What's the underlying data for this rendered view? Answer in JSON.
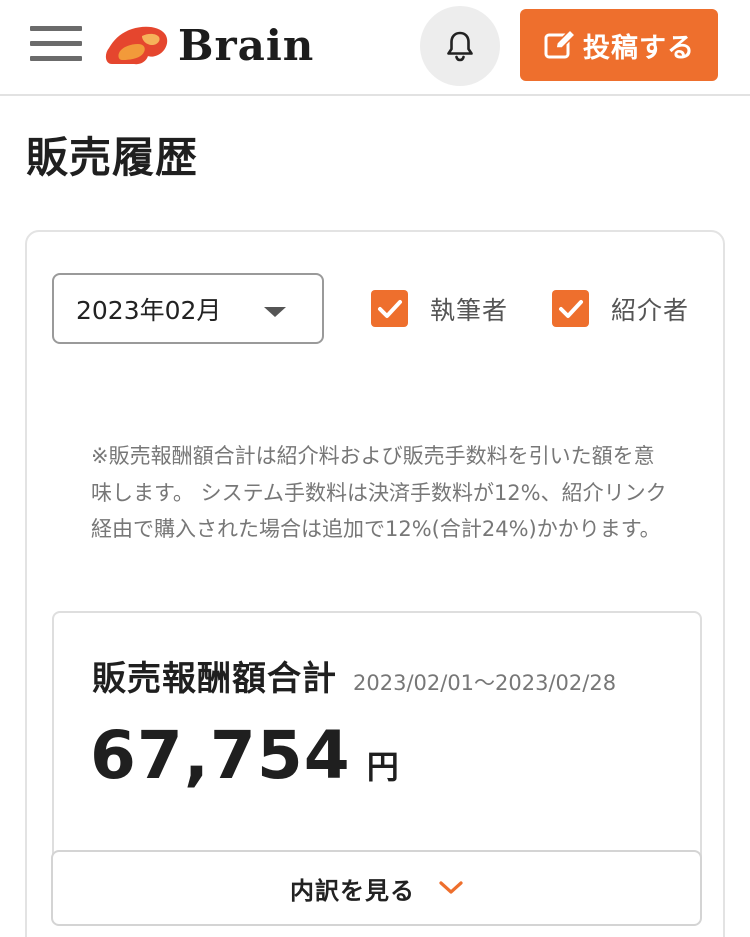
{
  "header": {
    "logo_text": "Brain",
    "post_button_label": "投稿する",
    "colors": {
      "accent": "#ee6f2d",
      "logo_red": "#e5462e",
      "logo_orange": "#f29a3a"
    },
    "icons": {
      "menu": "hamburger-icon",
      "notifications": "bell-icon",
      "post": "edit-icon"
    }
  },
  "page": {
    "title": "販売履歴"
  },
  "filters": {
    "month_value": "2023年02月",
    "checkboxes": [
      {
        "label": "執筆者",
        "checked": true
      },
      {
        "label": "紹介者",
        "checked": true
      }
    ]
  },
  "notice": "※販売報酬額合計は紹介料および販売手数料を引いた額を意味します。 システム手数料は決済手数料が12%、紹介リンク経由で購入された場合は追加で12%(合計24%)かかります。",
  "summary": {
    "title": "販売報酬額合計",
    "period": "2023/02/01〜2023/02/28",
    "amount": "67,754",
    "unit": "円"
  },
  "breakdown": {
    "label": "内訳を見る",
    "icon": "chevron-down-icon"
  }
}
